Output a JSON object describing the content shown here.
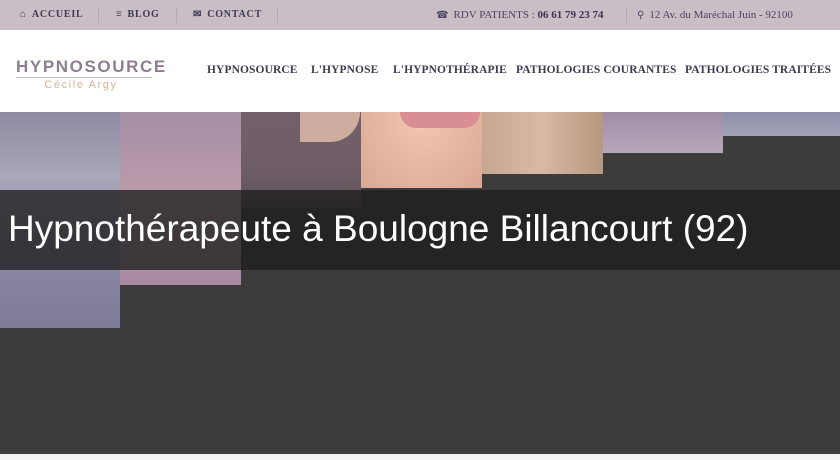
{
  "topbar": {
    "links": [
      {
        "icon": "home-icon",
        "glyph": "⌂",
        "label": "ACCUEIL"
      },
      {
        "icon": "rss-icon",
        "glyph": "≡",
        "label": "BLOG"
      },
      {
        "icon": "envelope-icon",
        "glyph": "✉",
        "label": "CONTACT"
      }
    ],
    "phone": {
      "icon": "phone-icon",
      "glyph": "☎",
      "prefix": "RDV PATIENTS : ",
      "number": "06 61 79 23 74"
    },
    "address": {
      "icon": "map-marker-icon",
      "glyph": "⚲",
      "text": "12 Av. du Maréchal Juin - 92100"
    }
  },
  "logo": {
    "name": "HYPNOSOURCE",
    "subtitle": "Cécile Argy"
  },
  "nav": {
    "items": [
      "HYPNOSOURCE",
      "L'HYPNOSE",
      "L'HYPNOTHÉRAPIE",
      "PATHOLOGIES COURANTES",
      "PATHOLOGIES TRAITÉES"
    ]
  },
  "hero": {
    "title": "Hypnothérapeute à Boulogne Billancourt (92)"
  },
  "colors": {
    "topbar_bg": "#c9bec6",
    "nav_text": "#3f3a52",
    "logo": "#8f7e92",
    "logo_sub": "#d4b494",
    "hero_bg": "#3c3c3c",
    "title_overlay": "#1e1e1e"
  }
}
